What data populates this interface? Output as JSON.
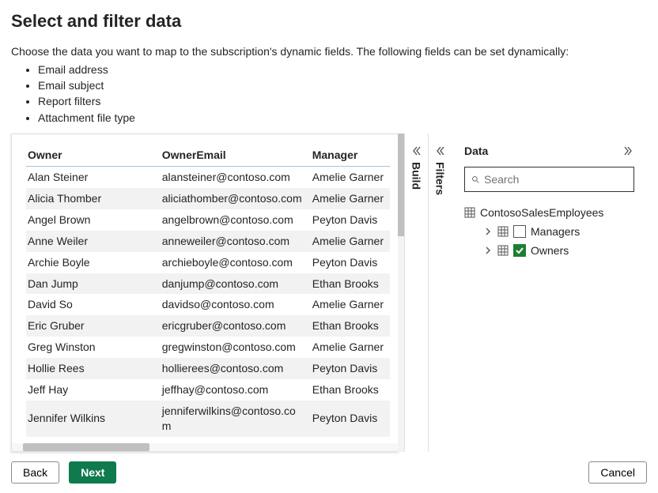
{
  "page": {
    "title": "Select and filter data",
    "lead": "Choose the data you want to map to the subscription's dynamic fields. The following fields can be set dynamically:",
    "bullets": [
      "Email address",
      "Email subject",
      "Report filters",
      "Attachment file type"
    ]
  },
  "table": {
    "columns": [
      "Owner",
      "OwnerEmail",
      "Manager"
    ],
    "rows": [
      {
        "c0": "Alan Steiner",
        "c1": "alansteiner@contoso.com",
        "c2": "Amelie Garner"
      },
      {
        "c0": "Alicia Thomber",
        "c1": "aliciathomber@contoso.com",
        "c2": "Amelie Garner"
      },
      {
        "c0": "Angel Brown",
        "c1": "angelbrown@contoso.com",
        "c2": "Peyton Davis"
      },
      {
        "c0": "Anne Weiler",
        "c1": "anneweiler@contoso.com",
        "c2": "Amelie Garner"
      },
      {
        "c0": "Archie Boyle",
        "c1": "archieboyle@contoso.com",
        "c2": "Peyton Davis"
      },
      {
        "c0": "Dan Jump",
        "c1": "danjump@contoso.com",
        "c2": "Ethan Brooks"
      },
      {
        "c0": "David So",
        "c1": "davidso@contoso.com",
        "c2": "Amelie Garner"
      },
      {
        "c0": "Eric Gruber",
        "c1": "ericgruber@contoso.com",
        "c2": "Ethan Brooks"
      },
      {
        "c0": "Greg Winston",
        "c1": "gregwinston@contoso.com",
        "c2": "Amelie Garner"
      },
      {
        "c0": "Hollie Rees",
        "c1": "hollierees@contoso.com",
        "c2": "Peyton Davis"
      },
      {
        "c0": "Jeff Hay",
        "c1": "jeffhay@contoso.com",
        "c2": "Ethan Brooks"
      },
      {
        "c0": "Jennifer Wilkins",
        "c1": "jenniferwilkins@contoso.com",
        "c2": "Peyton Davis"
      }
    ]
  },
  "panels": {
    "build": "Build",
    "filters": "Filters"
  },
  "data_panel": {
    "title": "Data",
    "search_placeholder": "Search",
    "dataset": "ContosoSalesEmployees",
    "tables": [
      {
        "name": "Managers",
        "checked": false
      },
      {
        "name": "Owners",
        "checked": true
      }
    ]
  },
  "footer": {
    "back": "Back",
    "next": "Next",
    "cancel": "Cancel"
  }
}
